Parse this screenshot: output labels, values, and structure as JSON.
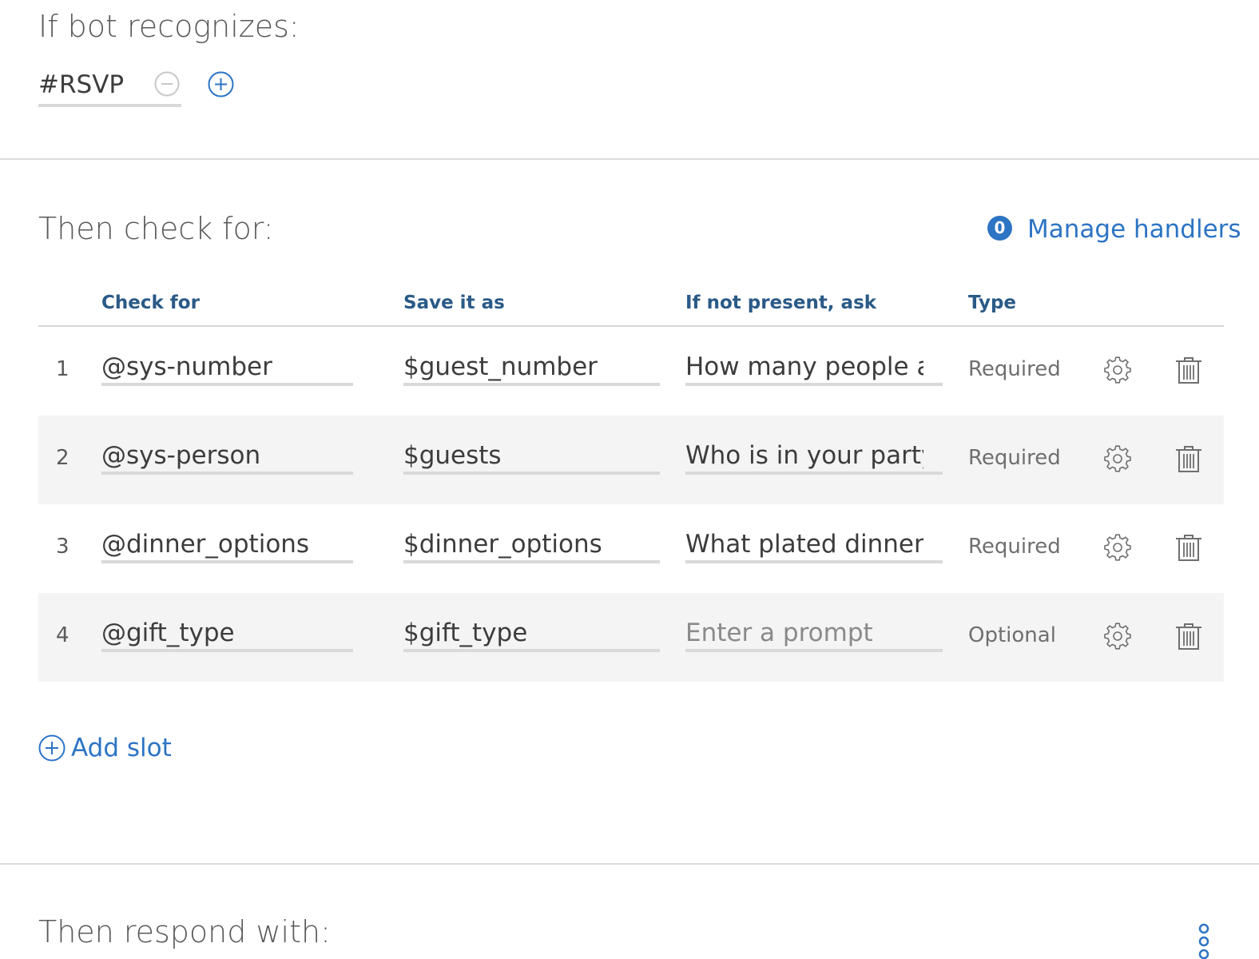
{
  "recognize": {
    "heading": "If bot recognizes:",
    "intent_value": "#RSVP"
  },
  "check": {
    "heading": "Then check for:",
    "handlers_count": "0",
    "handlers_label": "Manage handlers",
    "columns": {
      "check_for": "Check for",
      "save_as": "Save it as",
      "ask": "If not present, ask",
      "type": "Type"
    },
    "slots": [
      {
        "num": "1",
        "check_for": "@sys-number",
        "save_as": "$guest_number",
        "ask": "How many people are",
        "ask_is_placeholder": false,
        "type": "Required"
      },
      {
        "num": "2",
        "check_for": "@sys-person",
        "save_as": "$guests",
        "ask": "Who is in your party?",
        "ask_is_placeholder": false,
        "type": "Required"
      },
      {
        "num": "3",
        "check_for": "@dinner_options",
        "save_as": "$dinner_options",
        "ask": "What plated dinner w",
        "ask_is_placeholder": false,
        "type": "Required"
      },
      {
        "num": "4",
        "check_for": "@gift_type",
        "save_as": "$gift_type",
        "ask": "Enter a prompt",
        "ask_is_placeholder": true,
        "type": "Optional"
      }
    ],
    "add_slot_label": "Add slot"
  },
  "respond": {
    "heading": "Then respond with:"
  },
  "colors": {
    "accent": "#2d74c4",
    "header_text": "#2a5a87",
    "alt_row_bg": "#f4f4f4",
    "underline": "#d9d9d9"
  },
  "icons": [
    "minus-circle-icon",
    "plus-circle-icon",
    "gear-icon",
    "trash-icon",
    "overflow-menu-icon"
  ]
}
